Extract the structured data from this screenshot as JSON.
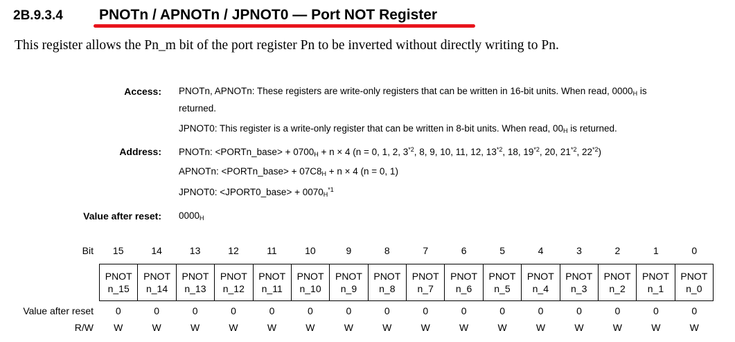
{
  "section": {
    "number": "2B.9.3.4",
    "title": "PNOTn / APNOTn / JPNOT0 — Port NOT Register",
    "intro": "This register allows the Pn_m bit of the port register Pn to be inverted without directly writing to Pn."
  },
  "access": {
    "label": "Access:",
    "line1a": "PNOTn, APNOTn: These registers are write-only registers that can be written in 16-bit units. When read, 0000",
    "line1b": " is",
    "line1c": "returned.",
    "line2a": "JPNOT0: This register is a write-only register that can be written in 8-bit units. When read, 00",
    "line2b": " is returned."
  },
  "address": {
    "label": "Address:",
    "pnot_a": "PNOTn: <PORTn_base> + 0700",
    "pnot_b": " + n × 4 (n = 0, 1, 2, 3",
    "pnot_c": ", 8, 9, 10, 11, 12, 13",
    "pnot_d": ", 18, 19",
    "pnot_e": ", 20, 21",
    "pnot_f": ", 22",
    "pnot_g": ")",
    "apnot_a": "APNOTn: <PORTn_base> + 07C8",
    "apnot_b": " + n × 4 (n = 0, 1)",
    "jpnot_a": "JPNOT0: <JPORT0_base> + 0070",
    "footnote1": "*1",
    "footnote2": "*2"
  },
  "reset": {
    "label": "Value after reset:",
    "value": "0000",
    "hex_suffix": "H"
  },
  "bit_table": {
    "bit_label": "Bit",
    "bits": [
      "15",
      "14",
      "13",
      "12",
      "11",
      "10",
      "9",
      "8",
      "7",
      "6",
      "5",
      "4",
      "3",
      "2",
      "1",
      "0"
    ],
    "fields": [
      [
        "PNOT",
        "n_15"
      ],
      [
        "PNOT",
        "n_14"
      ],
      [
        "PNOT",
        "n_13"
      ],
      [
        "PNOT",
        "n_12"
      ],
      [
        "PNOT",
        "n_11"
      ],
      [
        "PNOT",
        "n_10"
      ],
      [
        "PNOT",
        "n_9"
      ],
      [
        "PNOT",
        "n_8"
      ],
      [
        "PNOT",
        "n_7"
      ],
      [
        "PNOT",
        "n_6"
      ],
      [
        "PNOT",
        "n_5"
      ],
      [
        "PNOT",
        "n_4"
      ],
      [
        "PNOT",
        "n_3"
      ],
      [
        "PNOT",
        "n_2"
      ],
      [
        "PNOT",
        "n_1"
      ],
      [
        "PNOT",
        "n_0"
      ]
    ],
    "reset_label": "Value after reset",
    "reset_values": [
      "0",
      "0",
      "0",
      "0",
      "0",
      "0",
      "0",
      "0",
      "0",
      "0",
      "0",
      "0",
      "0",
      "0",
      "0",
      "0"
    ],
    "rw_label": "R/W",
    "rw_values": [
      "W",
      "W",
      "W",
      "W",
      "W",
      "W",
      "W",
      "W",
      "W",
      "W",
      "W",
      "W",
      "W",
      "W",
      "W",
      "W"
    ]
  },
  "colors": {
    "accent_underline": "#e8141c"
  }
}
